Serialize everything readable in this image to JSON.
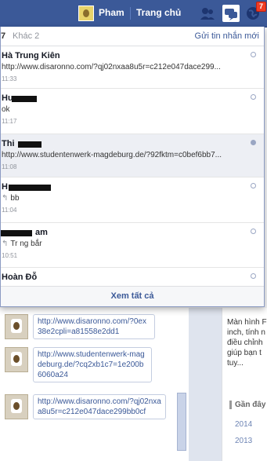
{
  "topbar": {
    "profile_name": "Pham",
    "home_label": "Trang chủ",
    "notification_count": "7",
    "accent": "#3b5998"
  },
  "messages_dropdown": {
    "count_label": "7",
    "other_label": "Khác 2",
    "new_message_label": "Gửi tin nhắn mới",
    "see_all_label": "Xem tất cả",
    "threads": [
      {
        "name": "Hà Trung Kiên",
        "snippet": "http://www.disaronno.com/?qj02nxaa8u5r=c212e047dace299...",
        "time": "11:33"
      },
      {
        "name": "Hu",
        "snippet": "ok",
        "time": "11:17"
      },
      {
        "name": "Thi",
        "snippet": "http://www.studentenwerk-magdeburg.de/?92fktm=c0bef6bb7...",
        "time": "11:08"
      },
      {
        "name": "H",
        "snippet": "bb",
        "time": "11:04"
      },
      {
        "name": "am",
        "snippet": "Tr ng bắr",
        "time": "10:51"
      },
      {
        "name": "Hoàn Đỗ",
        "snippet": "",
        "time": ""
      }
    ]
  },
  "chat_window": {
    "messages": [
      {
        "text": "http://www.disaronno.com/?0ex38e2cpli=a81558e2dd1"
      },
      {
        "text": "http://www.studentenwerk-magdeburg.de/?cq2xb1c7=1e200b6060a24"
      },
      {
        "text": "http://www.disaronno.com/?qj02nxaa8u5r=c212e047dace299bb0cf"
      }
    ]
  },
  "background_panel": {
    "text": "Màn hình F inch, tính n điều chỉnh giúp bạn t tuy...",
    "recent_label": "Gần đây",
    "years": [
      "2014",
      "2013"
    ]
  }
}
